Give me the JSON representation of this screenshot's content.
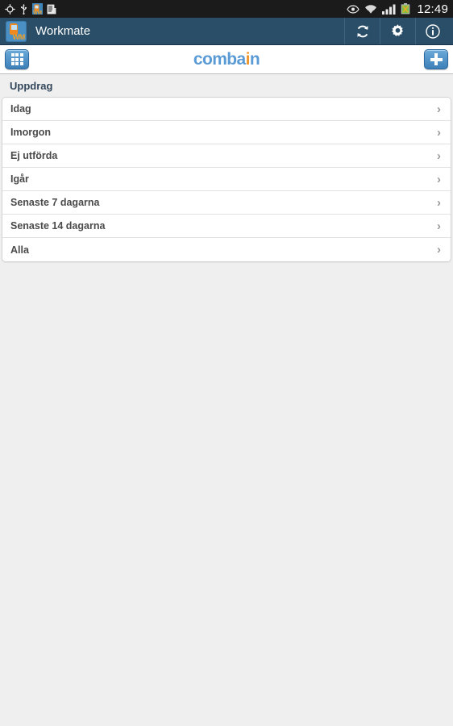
{
  "statusbar": {
    "time": "12:49",
    "left_icons": [
      "gps-icon",
      "usb-icon",
      "workmate-notification-icon",
      "sim-card-icon"
    ],
    "right_icons": [
      "smart-stay-eye-icon",
      "wifi-icon",
      "cellular-signal-icon",
      "battery-charging-icon"
    ]
  },
  "appbar": {
    "app_icon_label": "WM",
    "title": "Workmate",
    "actions": [
      {
        "name": "refresh-button",
        "icon": "refresh-icon"
      },
      {
        "name": "settings-button",
        "icon": "gear-icon"
      },
      {
        "name": "info-button",
        "icon": "info-icon"
      }
    ]
  },
  "logobar": {
    "menu_button_icon": "grid-icon",
    "add_button_icon": "plus-icon",
    "logo_part1": "comba",
    "logo_part2": "i",
    "logo_part3": "n"
  },
  "main": {
    "section_title": "Uppdrag",
    "items": [
      {
        "label": "Idag"
      },
      {
        "label": "Imorgon"
      },
      {
        "label": "Ej utförda"
      },
      {
        "label": "Igår"
      },
      {
        "label": "Senaste 7 dagarna"
      },
      {
        "label": "Senaste 14 dagarna"
      },
      {
        "label": "Alla"
      }
    ],
    "chevron": "›"
  },
  "colors": {
    "appbar": "#2a4e68",
    "logo_blue": "#5b9bd5",
    "logo_orange": "#f0962a",
    "background": "#efefef"
  }
}
